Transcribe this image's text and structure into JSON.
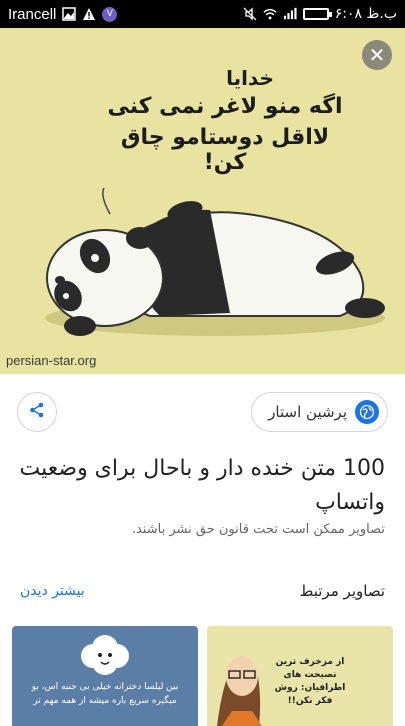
{
  "status_bar": {
    "carrier": "Irancell",
    "time": "۶:۰۸ ب.ظ",
    "icons": [
      "image-icon",
      "warning-icon",
      "viber-icon",
      "mute-icon",
      "wifi-icon",
      "signal-icon",
      "battery-icon"
    ],
    "viber_letter": "V"
  },
  "hero": {
    "caption_line1": "خدایا",
    "caption_line2": "اگه منو لاغر نمی کنی",
    "caption_line3": "لااقل دوستامو چاق کن!",
    "watermark": "persian-star.org",
    "close_icon": "close-icon",
    "background": "#e8e3a0"
  },
  "source": {
    "name": "پرشین استار",
    "share_icon": "share-icon",
    "globe_icon": "globe-icon"
  },
  "title": "100 متن خنده دار و باحال برای وضعیت واتساپ",
  "copyright": "تصاویر ممکن است تحت قانون حق نشر باشند.",
  "related": {
    "heading": "تصاویر مرتبط",
    "more_label": "بیشتر دیدن",
    "thumbnails": [
      {
        "text": "بین لیلسا دخترانه خیلی بی جنبه اس، بو میگیره سریع باره میشه از همه مهم تر"
      },
      {
        "text": "از مزخرف ترین نصیحت های اطرافیان: روش فکر نکن!!"
      }
    ]
  },
  "colors": {
    "accent": "#1a73e8",
    "status_bar": "#000000"
  }
}
